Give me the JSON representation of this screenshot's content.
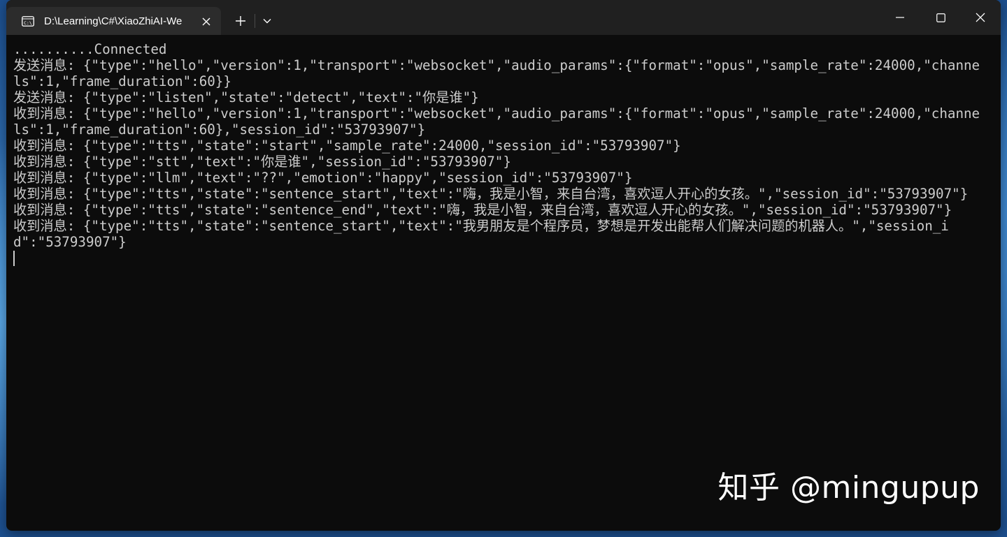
{
  "window": {
    "tab_title": "D:\\Learning\\C#\\XiaoZhiAI-We",
    "icons": {
      "tab_icon": "terminal-icon",
      "tab_close": "close-icon",
      "new_tab": "plus-icon",
      "dropdown": "chevron-down-icon",
      "minimize": "minimize-icon",
      "maximize": "maximize-icon",
      "close": "close-icon"
    }
  },
  "console": {
    "lines": [
      "..........Connected",
      "发送消息: {\"type\":\"hello\",\"version\":1,\"transport\":\"websocket\",\"audio_params\":{\"format\":\"opus\",\"sample_rate\":24000,\"channels\":1,\"frame_duration\":60}}",
      "发送消息: {\"type\":\"listen\",\"state\":\"detect\",\"text\":\"你是谁\"}",
      "收到消息: {\"type\":\"hello\",\"version\":1,\"transport\":\"websocket\",\"audio_params\":{\"format\":\"opus\",\"sample_rate\":24000,\"channels\":1,\"frame_duration\":60},\"session_id\":\"53793907\"}",
      "收到消息: {\"type\":\"tts\",\"state\":\"start\",\"sample_rate\":24000,\"session_id\":\"53793907\"}",
      "收到消息: {\"type\":\"stt\",\"text\":\"你是谁\",\"session_id\":\"53793907\"}",
      "收到消息: {\"type\":\"llm\",\"text\":\"??\",\"emotion\":\"happy\",\"session_id\":\"53793907\"}",
      "收到消息: {\"type\":\"tts\",\"state\":\"sentence_start\",\"text\":\"嗨，我是小智，来自台湾，喜欢逗人开心的女孩。\",\"session_id\":\"53793907\"}",
      "收到消息: {\"type\":\"tts\",\"state\":\"sentence_end\",\"text\":\"嗨，我是小智，来自台湾，喜欢逗人开心的女孩。\",\"session_id\":\"53793907\"}",
      "收到消息: {\"type\":\"tts\",\"state\":\"sentence_start\",\"text\":\"我男朋友是个程序员，梦想是开发出能帮人们解决问题的机器人。\",\"session_id\":\"53793907\"}"
    ]
  },
  "watermark": "知乎 @mingupup"
}
